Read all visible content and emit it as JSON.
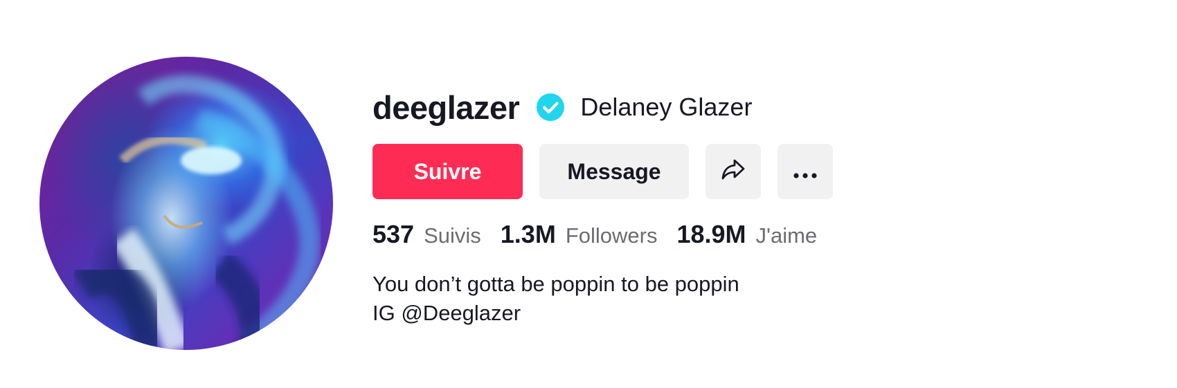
{
  "profile": {
    "username": "deeglazer",
    "nickname": "Delaney Glazer",
    "verified": true,
    "avatar_icon": "profile-photo"
  },
  "actions": {
    "follow_label": "Suivre",
    "message_label": "Message",
    "share_icon": "share-arrow-icon",
    "more_icon": "more-dots-icon"
  },
  "stats": [
    {
      "value": "537",
      "label": "Suivis"
    },
    {
      "value": "1.3M",
      "label": "Followers"
    },
    {
      "value": "18.9M",
      "label": "J'aime"
    }
  ],
  "bio": {
    "line1": "You don’t gotta be poppin to be poppin",
    "line2": "IG @Deeglazer"
  },
  "colors": {
    "follow": "#fe2c55",
    "secondary_button": "#f1f1f2",
    "verified": "#20d5ec",
    "text": "#161823",
    "muted": "#6b6c72"
  }
}
